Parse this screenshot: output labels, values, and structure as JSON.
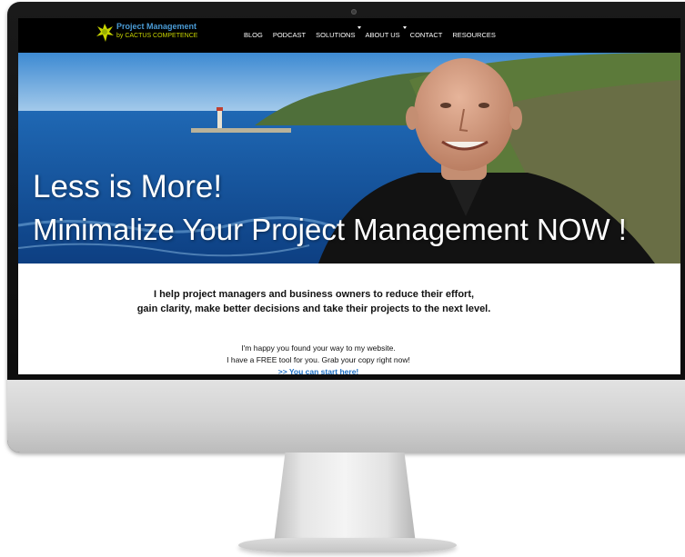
{
  "site": {
    "logo": {
      "title": "Project Management",
      "subtitle": "by CACTUS COMPETENCE",
      "icon": "cactus-logo-icon"
    },
    "nav": {
      "items": [
        {
          "label": "BLOG",
          "has_dropdown": false
        },
        {
          "label": "PODCAST",
          "has_dropdown": false
        },
        {
          "label": "SOLUTIONS",
          "has_dropdown": true
        },
        {
          "label": "ABOUT US",
          "has_dropdown": true
        },
        {
          "label": "CONTACT",
          "has_dropdown": false
        },
        {
          "label": "RESOURCES",
          "has_dropdown": false
        }
      ]
    },
    "hero": {
      "line1": "Less is More!",
      "line2": "Minimalize Your Project Management NOW !"
    },
    "intro": {
      "line1": "I help project managers and business owners to reduce their effort,",
      "line2": "gain clarity, make better decisions and take their projects to the next level."
    },
    "welcome": {
      "line1": "I'm happy you found your way to my website.",
      "line2": "I have a FREE tool for you. Grab your copy right now!",
      "link": ">> You can start here!"
    }
  },
  "colors": {
    "nav_bg": "#000000",
    "logo_title": "#4a9bd5",
    "logo_sub": "#c8d400",
    "link": "#1d6fc4"
  }
}
